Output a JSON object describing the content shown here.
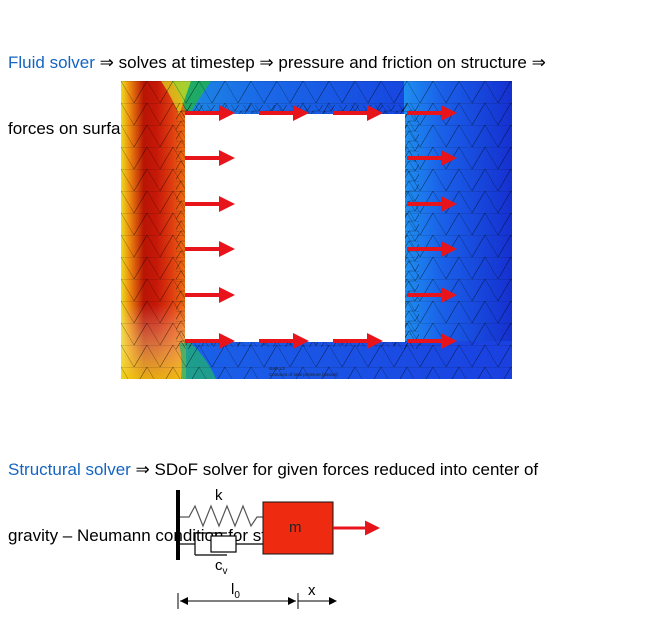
{
  "fluid_paragraph": {
    "highlight": "Fluid solver",
    "line1_rest": " ⇒ solves at timestep ⇒ pressure and friction on structure ⇒",
    "line2": "forces on surface nodes ⇒ passed to structural solver as input"
  },
  "fluid_figure": {
    "caption_line1": "step 1/2",
    "caption_line2": "Contours of total pressure (pascal)"
  },
  "structural_paragraph": {
    "highlight": "Structural solver",
    "line1_rest": " ⇒ SDoF solver for given forces reduced into center of",
    "line2": "gravity – Neumann condition for structure"
  },
  "sdof_diagram": {
    "spring_label": "k",
    "mass_label": "m",
    "damper_label_main": "c",
    "damper_label_sub": "v",
    "length_label_main": "l",
    "length_label_sub": "0",
    "displacement_label": "x"
  },
  "colors": {
    "highlight_text": "#1565c0",
    "force_arrow": "#e8141b",
    "mass_fill": "#ee2a10",
    "mesh_low": "#1a3fe0",
    "mesh_high": "#b81405"
  }
}
